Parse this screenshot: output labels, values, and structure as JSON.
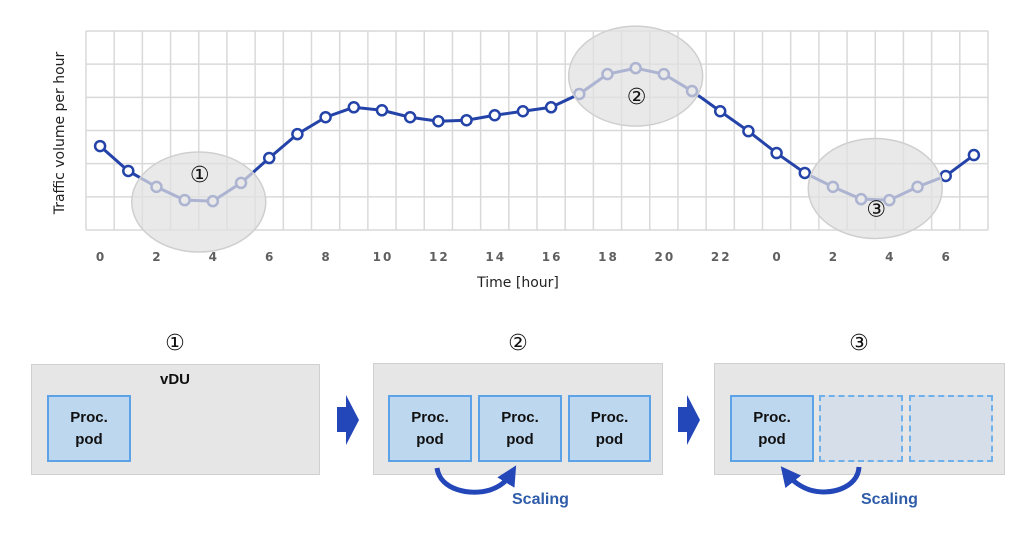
{
  "chart_data": {
    "type": "line",
    "title": "",
    "xlabel": "Time [hour]",
    "ylabel": "Traffic volume per hour",
    "x": [
      0,
      1,
      2,
      3,
      4,
      5,
      6,
      7,
      8,
      9,
      10,
      11,
      12,
      13,
      14,
      15,
      16,
      17,
      18,
      19,
      20,
      21,
      22,
      23,
      0,
      1,
      2,
      3,
      4,
      5,
      6,
      7
    ],
    "xtick_labels": [
      "0",
      "",
      "2",
      "",
      "4",
      "",
      "6",
      "",
      "8",
      "",
      "10",
      "",
      "12",
      "",
      "14",
      "",
      "16",
      "",
      "18",
      "",
      "20",
      "",
      "22",
      "",
      "0",
      "",
      "2",
      "",
      "4",
      "",
      "6",
      ""
    ],
    "values": [
      2.53,
      1.78,
      1.3,
      0.9,
      0.87,
      1.42,
      2.17,
      2.89,
      3.4,
      3.7,
      3.61,
      3.4,
      3.28,
      3.31,
      3.46,
      3.58,
      3.7,
      4.1,
      4.7,
      4.88,
      4.7,
      4.19,
      3.58,
      2.98,
      2.32,
      1.72,
      1.3,
      0.93,
      0.9,
      1.3,
      1.63,
      2.26
    ],
    "ylim": [
      0,
      6
    ],
    "y_gridlines": 6,
    "grid": true,
    "series_color": "#2443a8",
    "highlights": [
      {
        "label": "①",
        "from_index": 2,
        "to_index": 5
      },
      {
        "label": "②",
        "from_index": 17,
        "to_index": 21
      },
      {
        "label": "③",
        "from_index": 26,
        "to_index": 29
      }
    ]
  },
  "diagram": {
    "steps": [
      {
        "label": "①",
        "container": "vDU",
        "pods": [
          "Proc.\npod"
        ],
        "ghost_pods": 0
      },
      {
        "label": "②",
        "container": "",
        "pods": [
          "Proc.\npod",
          "Proc.\npod",
          "Proc.\npod"
        ],
        "ghost_pods": 0,
        "action": "Scaling"
      },
      {
        "label": "③",
        "container": "",
        "pods": [
          "Proc.\npod"
        ],
        "ghost_pods": 2,
        "action": "Scaling"
      }
    ],
    "pod_line1": "Proc.",
    "pod_line2": "pod",
    "arrow_color": "#2346b8"
  }
}
